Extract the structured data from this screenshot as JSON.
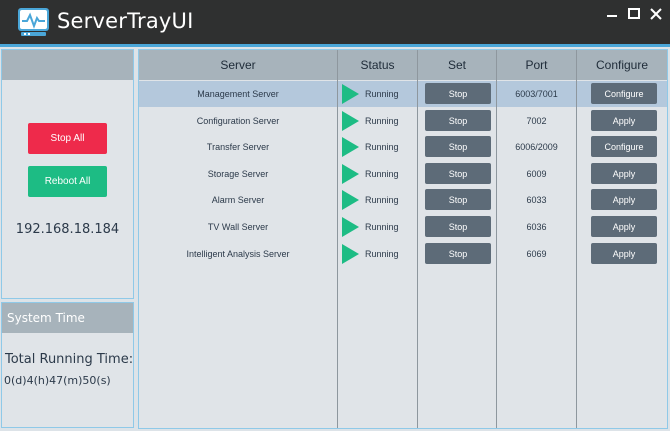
{
  "app": {
    "title": "ServerTrayUI"
  },
  "colors": {
    "titlebar": "#2f3030",
    "accent": "#4aa6d8",
    "danger": "#ee2a4b",
    "success": "#1dbc84",
    "button": "#5d6b78"
  },
  "actions": {
    "stop_all": "Stop All",
    "reboot_all": "Reboot All"
  },
  "ip_address": "192.168.18.184",
  "system_time": {
    "title": "System Time",
    "total_label": "Total Running Time:",
    "total_value": "0(d)4(h)47(m)50(s)"
  },
  "table": {
    "columns": {
      "server": "Server",
      "status": "Status",
      "set": "Set",
      "port": "Port",
      "configure": "Configure"
    },
    "rows": [
      {
        "server": "Management Server",
        "status": "Running",
        "set": "Stop",
        "port": "6003/7001",
        "configure": "Configure"
      },
      {
        "server": "Configuration Server",
        "status": "Running",
        "set": "Stop",
        "port": "7002",
        "configure": "Apply"
      },
      {
        "server": "Transfer Server",
        "status": "Running",
        "set": "Stop",
        "port": "6006/2009",
        "configure": "Configure"
      },
      {
        "server": "Storage Server",
        "status": "Running",
        "set": "Stop",
        "port": "6009",
        "configure": "Apply"
      },
      {
        "server": "Alarm Server",
        "status": "Running",
        "set": "Stop",
        "port": "6033",
        "configure": "Apply"
      },
      {
        "server": "TV Wall Server",
        "status": "Running",
        "set": "Stop",
        "port": "6036",
        "configure": "Apply"
      },
      {
        "server": "Intelligent Analysis Server",
        "status": "Running",
        "set": "Stop",
        "port": "6069",
        "configure": "Apply"
      }
    ]
  }
}
